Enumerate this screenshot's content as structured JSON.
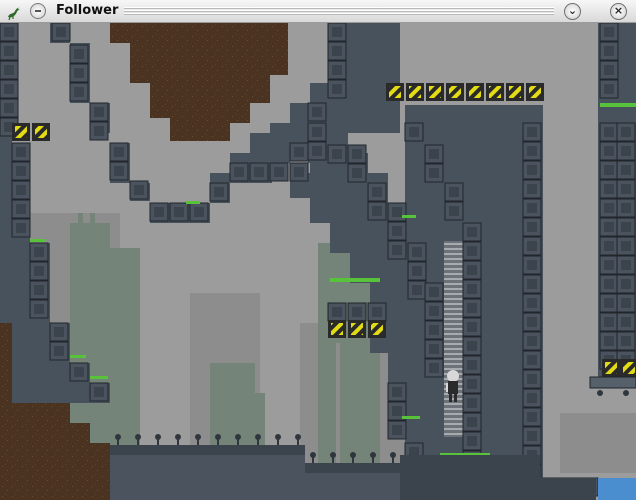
{
  "window": {
    "title": "Follower",
    "app_icon": "lizard-icon",
    "controls": {
      "menu": "window-menu-icon",
      "shade": "chevron-down-icon",
      "close": "close-icon"
    }
  },
  "game": {
    "palette": {
      "sky": "#9c9c9c",
      "far_silhouette": "#8a8a8a",
      "mid_silhouette": "#738377",
      "cave_fill": "#48525c",
      "block": "#3b434d",
      "block_face": "#4a535e",
      "dirt": "#4a3421",
      "dirt_speck": "#6b4d30",
      "hazard_yellow": "#e3dc12",
      "hazard_dark": "#2a2a2a",
      "moss": "#58c23a",
      "water": "#4a8ed0",
      "ladder": "#8b9196"
    },
    "player": {
      "name": "player-character",
      "hair": "#d8d8d8",
      "body": "#2b2b2b"
    },
    "tiles": {
      "blocks": [],
      "hazards": []
    }
  }
}
